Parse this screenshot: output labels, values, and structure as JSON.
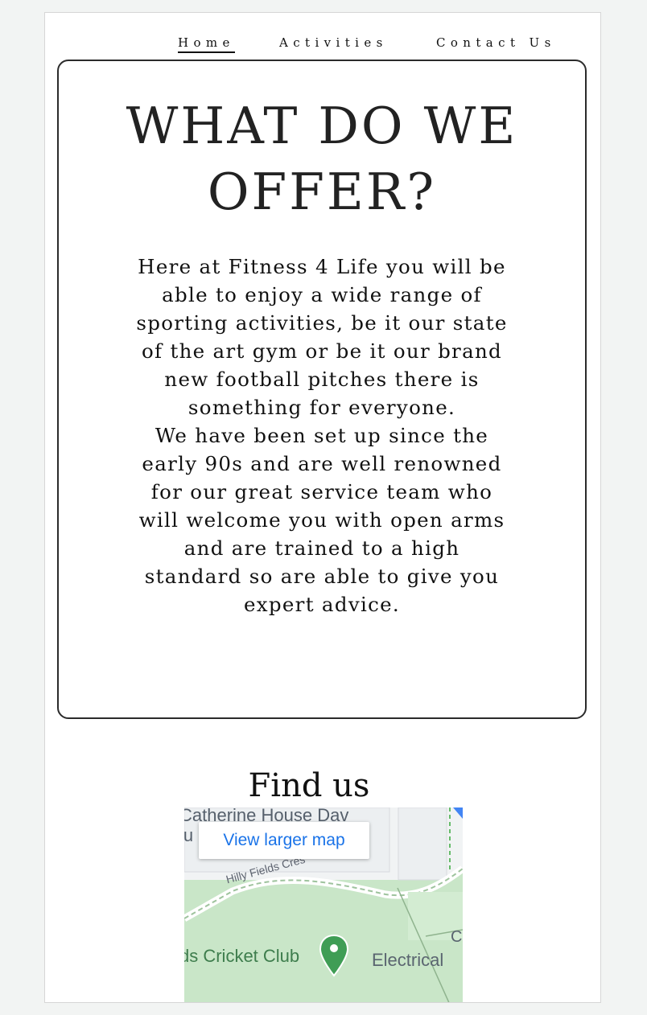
{
  "nav": {
    "items": [
      {
        "label": "Home",
        "active": true
      },
      {
        "label": "Activities",
        "active": false
      },
      {
        "label": "Contact Us",
        "active": false
      }
    ]
  },
  "offer": {
    "title_line1": "WHAT DO WE",
    "title_line2": "OFFER?",
    "paragraph1": "Here at Fitness 4 Life you will be able to enjoy a wide range of sporting activities, be it our state of the art gym or be it our brand new football pitches there is something for everyone.",
    "paragraph2": "We have been set up since the early 90s and are well renowned for our great service team who will welcome you with open arms and are trained to a high standard so are able to give you expert advice."
  },
  "find_us": {
    "heading": "Find us",
    "map": {
      "larger_map_label": "View larger map",
      "place_top": "Catherine House Dav",
      "place_top2": "lu",
      "street": "Hilly Fields Cres",
      "club": "ds Cricket Club",
      "electrical": "Electrical",
      "corner_letter": "C",
      "pin_icon": "map-pin-icon"
    }
  },
  "colors": {
    "background": "#f2f4f3",
    "border": "#2b2b2b",
    "map_green": "#c9e6c8",
    "map_link": "#1a73e8"
  }
}
